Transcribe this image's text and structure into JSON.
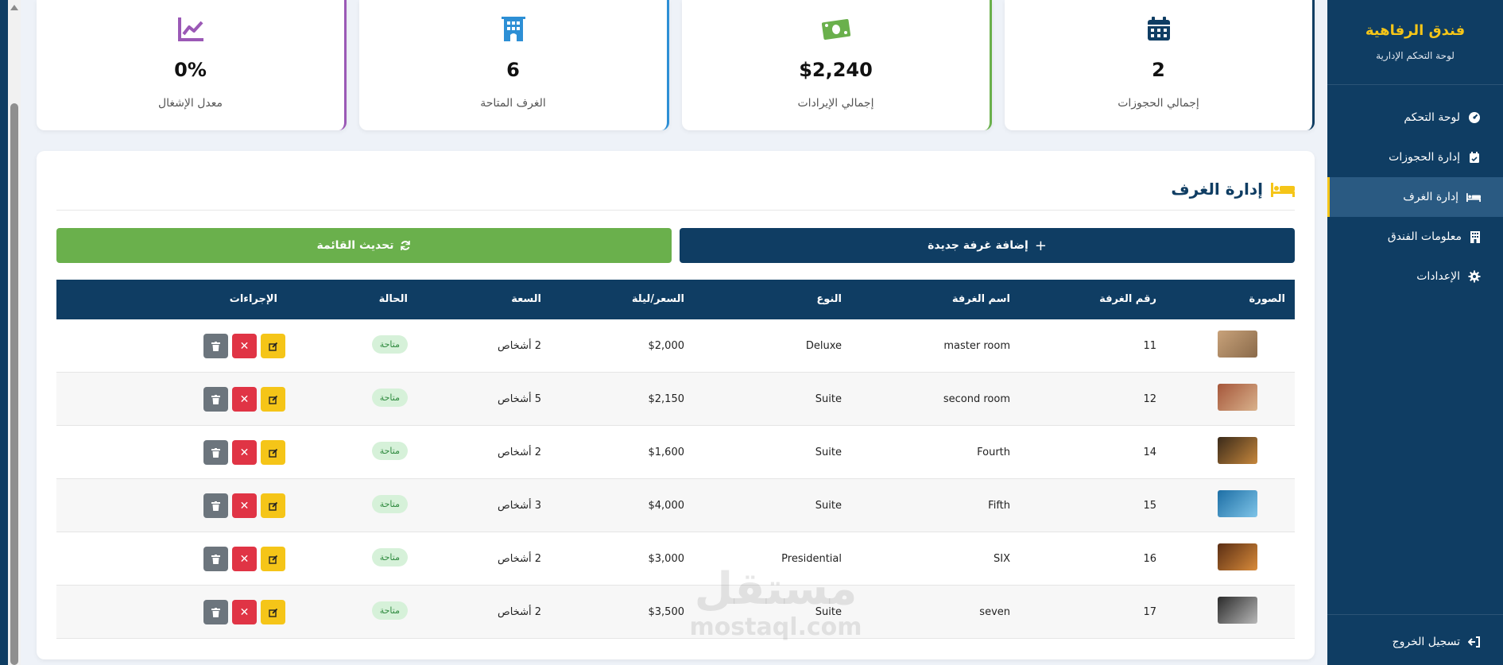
{
  "sidebar": {
    "brand_title": "فندق الرفاهية",
    "brand_subtitle": "لوحة التحكم الإدارية",
    "items": [
      {
        "label": "لوحة التحكم",
        "icon": "gauge-icon"
      },
      {
        "label": "إدارة الحجوزات",
        "icon": "calendar-check-icon"
      },
      {
        "label": "إدارة الغرف",
        "icon": "bed-icon",
        "active": true
      },
      {
        "label": "معلومات الفندق",
        "icon": "building-icon"
      },
      {
        "label": "الإعدادات",
        "icon": "gear-icon"
      }
    ],
    "logout_label": "تسجيل الخروج"
  },
  "stats": [
    {
      "value": "2",
      "label": "إجمالي الحجوزات",
      "icon": "calendar-icon",
      "color": "#0f3d63"
    },
    {
      "value": "$2,240",
      "label": "إجمالي الإيرادات",
      "icon": "money-icon",
      "color": "#6ab04c"
    },
    {
      "value": "6",
      "label": "الغرف المتاحة",
      "icon": "hotel-icon",
      "color": "#2d8fd5"
    },
    {
      "value": "0%",
      "label": "معدل الإشغال",
      "icon": "chart-line-icon",
      "color": "#9b59b6"
    }
  ],
  "rooms_panel": {
    "title": "إدارة الغرف",
    "add_button": "إضافة غرفة جديدة",
    "refresh_button": "تحديث القائمة",
    "columns": [
      "الصورة",
      "رقم الغرفة",
      "اسم الغرفة",
      "النوع",
      "السعر/ليلة",
      "السعة",
      "الحالة",
      "الإجراءات"
    ],
    "rows": [
      {
        "number": "11",
        "name": "master room",
        "type": "Deluxe",
        "price": "$2,000",
        "capacity": "2 أشخاص",
        "status": "متاحة"
      },
      {
        "number": "12",
        "name": "second room",
        "type": "Suite",
        "price": "$2,150",
        "capacity": "5 أشخاص",
        "status": "متاحة"
      },
      {
        "number": "14",
        "name": "Fourth",
        "type": "Suite",
        "price": "$1,600",
        "capacity": "2 أشخاص",
        "status": "متاحة"
      },
      {
        "number": "15",
        "name": "Fifth",
        "type": "Suite",
        "price": "$4,000",
        "capacity": "3 أشخاص",
        "status": "متاحة"
      },
      {
        "number": "16",
        "name": "SIX",
        "type": "Presidential",
        "price": "$3,000",
        "capacity": "2 أشخاص",
        "status": "متاحة"
      },
      {
        "number": "17",
        "name": "seven",
        "type": "Suite",
        "price": "$3,500",
        "capacity": "2 أشخاص",
        "status": "متاحة"
      }
    ]
  },
  "watermark": {
    "line1": "مستقل",
    "line2": "mostaql.com"
  }
}
